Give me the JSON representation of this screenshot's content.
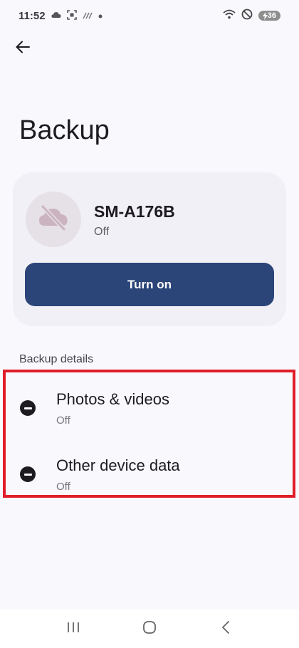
{
  "status_bar": {
    "time": "11:52",
    "battery": "36",
    "icons": [
      "cloud-icon",
      "screenshot-icon",
      "signal-slash-icon",
      "dot-icon",
      "wifi-icon",
      "do-not-disturb-icon",
      "battery-charging-icon"
    ]
  },
  "header": {
    "back_icon": "arrow-left-icon",
    "title": "Backup"
  },
  "device": {
    "icon": "cloud-off-icon",
    "name": "SM-A176B",
    "status": "Off",
    "turn_on_label": "Turn on"
  },
  "backup_details": {
    "label": "Backup details",
    "items": [
      {
        "title": "Photos & videos",
        "status": "Off",
        "icon": "minus-circle-icon"
      },
      {
        "title": "Other device data",
        "status": "Off",
        "icon": "minus-circle-icon"
      }
    ]
  },
  "nav_bar": {
    "icons": [
      "recent-apps-icon",
      "home-icon",
      "back-icon"
    ]
  },
  "colors": {
    "background": "#f9f8fd",
    "card": "#f1f0f6",
    "primary_button": "#2b4578",
    "highlight": "#e11d2a"
  }
}
